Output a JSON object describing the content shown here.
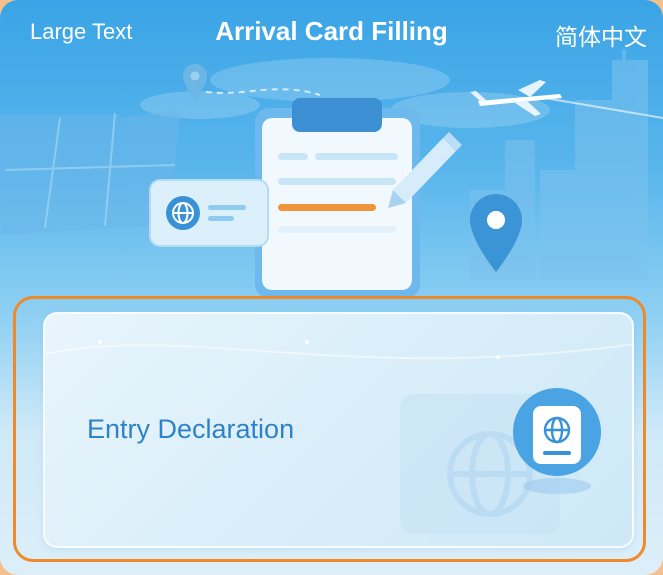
{
  "header": {
    "left_label": "Large Text",
    "title": "Arrival Card Filling",
    "right_label": "简体中文"
  },
  "hero": {
    "icons": [
      "location-pin-icon",
      "airplane-icon",
      "clipboard-icon",
      "globe-card-icon",
      "pencil-icon"
    ]
  },
  "entry_card": {
    "label": "Entry Declaration",
    "icon": "passport-globe-icon"
  },
  "colors": {
    "accent_orange": "#ef8a2a",
    "text_blue": "#2f82c9",
    "sky_blue": "#3aa4e6"
  }
}
